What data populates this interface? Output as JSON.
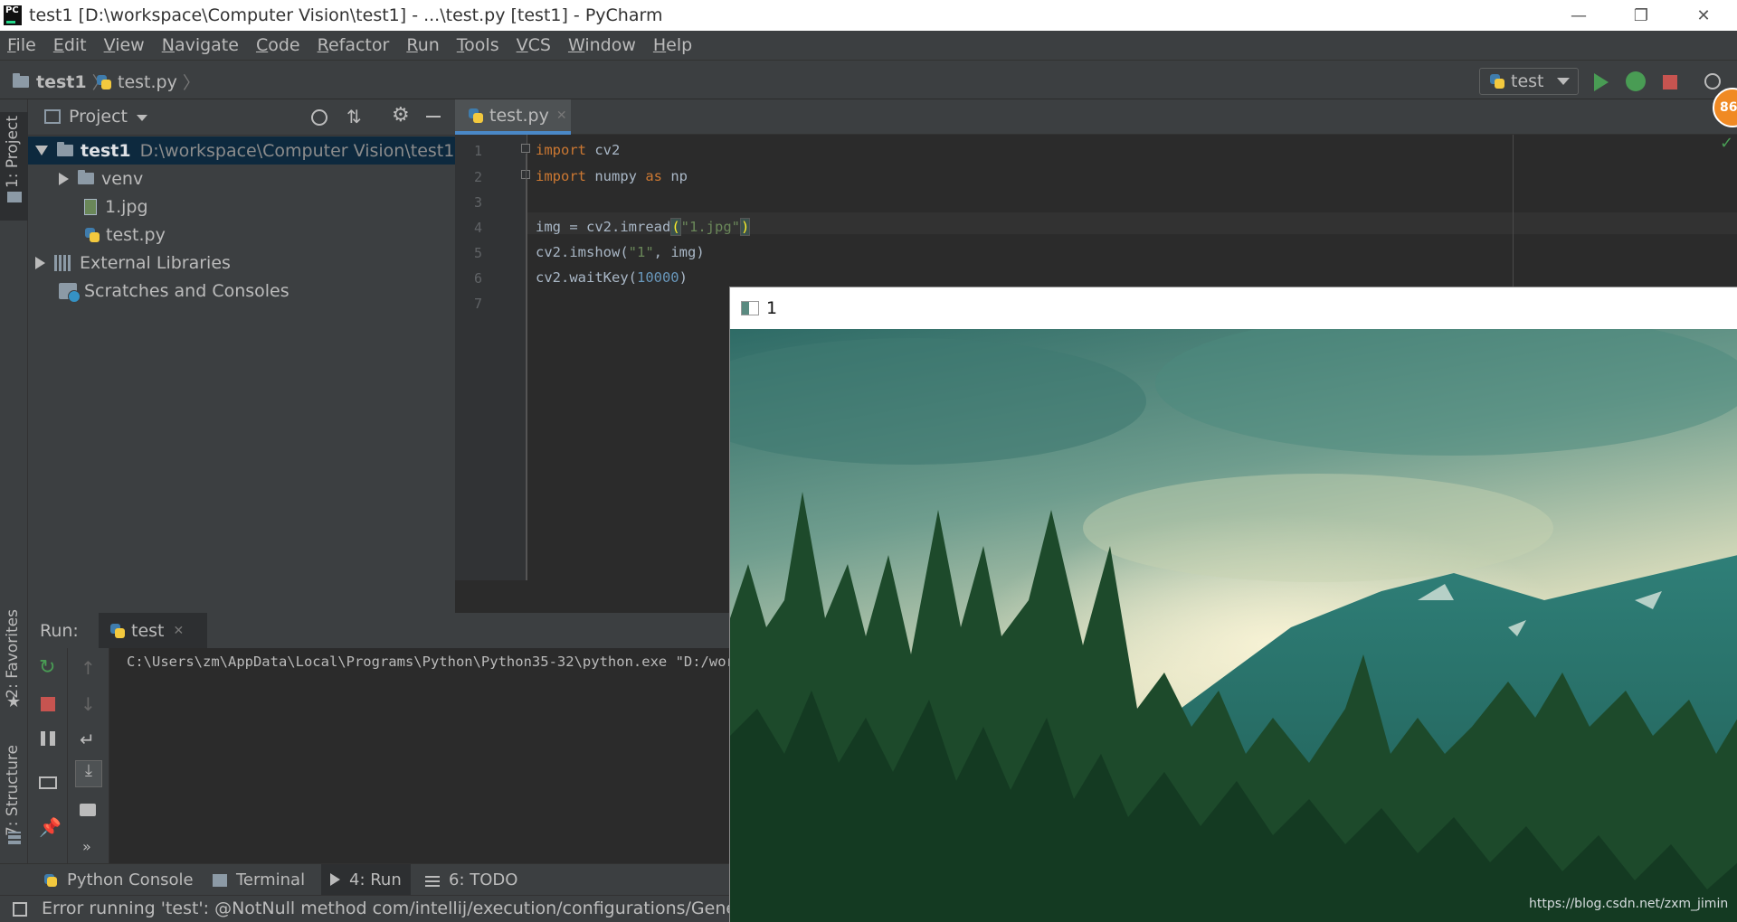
{
  "window": {
    "logo": "PC",
    "title": "test1 [D:\\workspace\\Computer Vision\\test1] - ...\\test.py [test1] - PyCharm",
    "minimize": "—",
    "restore": "❐",
    "close": "✕"
  },
  "menu": [
    "File",
    "Edit",
    "View",
    "Navigate",
    "Code",
    "Refactor",
    "Run",
    "Tools",
    "VCS",
    "Window",
    "Help"
  ],
  "nav": {
    "project": "test1",
    "file": "test.py",
    "run_config": "test",
    "badge": "86"
  },
  "left_stripe": {
    "project": "1: Project",
    "favorites": "2: Favorites",
    "structure": "7: Structure"
  },
  "project_panel": {
    "title": "Project",
    "tree": [
      {
        "name": "test1",
        "path": "D:\\workspace\\Computer Vision\\test1"
      },
      {
        "name": "venv"
      },
      {
        "name": "1.jpg"
      },
      {
        "name": "test.py"
      },
      {
        "name": "External Libraries"
      },
      {
        "name": "Scratches and Consoles"
      }
    ]
  },
  "editor": {
    "tab": "test.py",
    "line_numbers": [
      "1",
      "2",
      "3",
      "4",
      "5",
      "6",
      "7"
    ],
    "code": {
      "l1_kw": "import",
      "l1_rest": " cv2",
      "l2_kw": "import",
      "l2_mid": " numpy ",
      "l2_kw2": "as",
      "l2_rest": " np",
      "l4_a": "img = cv2.imread",
      "l4_po": "(",
      "l4_str": "\"1.jpg\"",
      "l4_pc": ")",
      "l5_a": "cv2.imshow(",
      "l5_str": "\"1\"",
      "l5_b": ", img)",
      "l6_a": "cv2.waitKey(",
      "l6_num": "10000",
      "l6_b": ")"
    }
  },
  "run_panel": {
    "label": "Run:",
    "tab": "test",
    "console": "C:\\Users\\zm\\AppData\\Local\\Programs\\Python\\Python35-32\\python.exe \"D:/works"
  },
  "bottom_tabs": [
    {
      "label": "Python Console"
    },
    {
      "label": "Terminal"
    },
    {
      "label": "4: Run"
    },
    {
      "label": "6: TODO"
    }
  ],
  "status": "Error running 'test': @NotNull method com/intellij/execution/configurations/GeneralCo",
  "image_window": {
    "title": "1"
  },
  "watermark": "https://blog.csdn.net/zxm_jimin"
}
